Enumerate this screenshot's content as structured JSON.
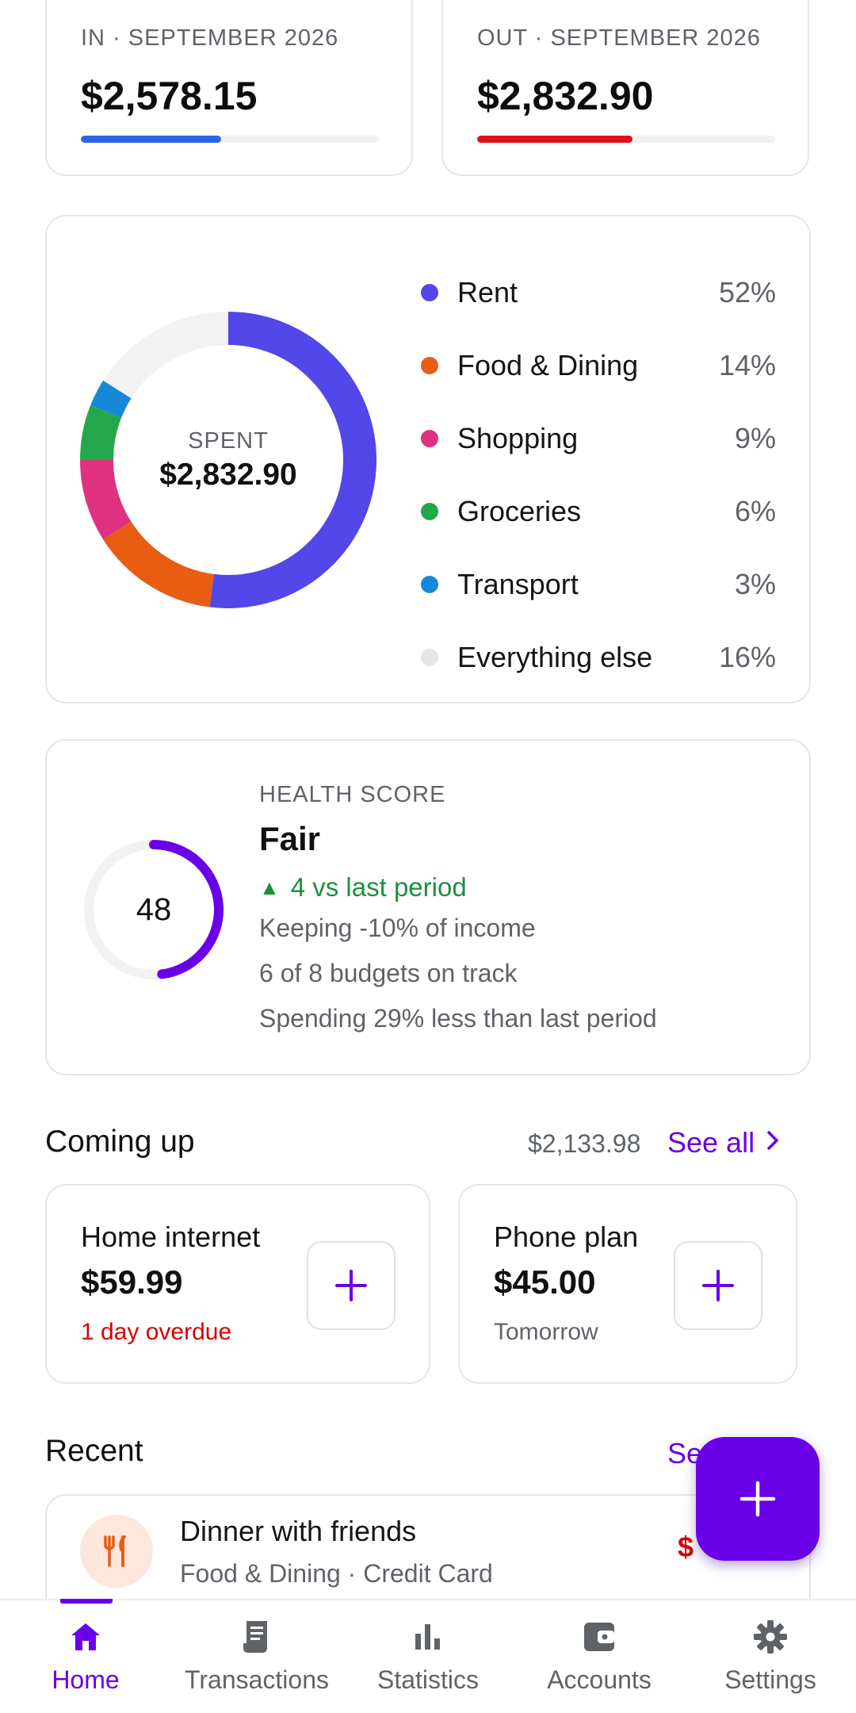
{
  "summary": {
    "in": {
      "label": "IN · SEPTEMBER 2026",
      "amount": "$2,578.15",
      "progress": 0.47,
      "color": "#2b66e8"
    },
    "out": {
      "label": "OUT · SEPTEMBER 2026",
      "amount": "$2,832.90",
      "progress": 0.52,
      "color": "#e0111b"
    }
  },
  "breakdown": {
    "center_label": "SPENT",
    "center_value": "$2,832.90",
    "categories": [
      {
        "name": "Rent",
        "pct": "52%",
        "share": 52,
        "color": "#5247e8"
      },
      {
        "name": "Food & Dining",
        "pct": "14%",
        "share": 14,
        "color": "#e85d12"
      },
      {
        "name": "Shopping",
        "pct": "9%",
        "share": 9,
        "color": "#de3280"
      },
      {
        "name": "Groceries",
        "pct": "6%",
        "share": 6,
        "color": "#22a84a"
      },
      {
        "name": "Transport",
        "pct": "3%",
        "share": 3,
        "color": "#1688d8"
      },
      {
        "name": "Everything else",
        "pct": "16%",
        "share": 16,
        "color": "#f2f2f2"
      }
    ]
  },
  "health": {
    "kicker": "HEALTH SCORE",
    "score": "48",
    "score_fraction": 0.48,
    "grade": "Fair",
    "delta": "4 vs last period",
    "lines": [
      "Keeping -10% of income",
      "6 of 8 budgets on track",
      "Spending 29% less than last period"
    ],
    "accent": "#6a00e8"
  },
  "coming_up": {
    "title": "Coming up",
    "total": "$2,133.98",
    "see_all": "See all",
    "bills": [
      {
        "name": "Home internet",
        "amount": "$59.99",
        "status": "1 day overdue",
        "status_color": "#d50000"
      },
      {
        "name": "Phone plan",
        "amount": "$45.00",
        "status": "Tomorrow",
        "status_color": "#5f6368"
      }
    ]
  },
  "recent": {
    "title": "Recent",
    "see_all": "Se",
    "items": [
      {
        "title": "Dinner with friends",
        "subtitle": "Food & Dining · Credit Card",
        "amount": "$",
        "icon": "fork-knife-icon"
      }
    ]
  },
  "fab": {
    "label": "+"
  },
  "nav": {
    "items": [
      {
        "label": "Home",
        "icon": "home-icon",
        "active": true
      },
      {
        "label": "Transactions",
        "icon": "receipt-icon",
        "active": false
      },
      {
        "label": "Statistics",
        "icon": "bar-chart-icon",
        "active": false
      },
      {
        "label": "Accounts",
        "icon": "wallet-icon",
        "active": false
      },
      {
        "label": "Settings",
        "icon": "gear-icon",
        "active": false
      }
    ]
  }
}
